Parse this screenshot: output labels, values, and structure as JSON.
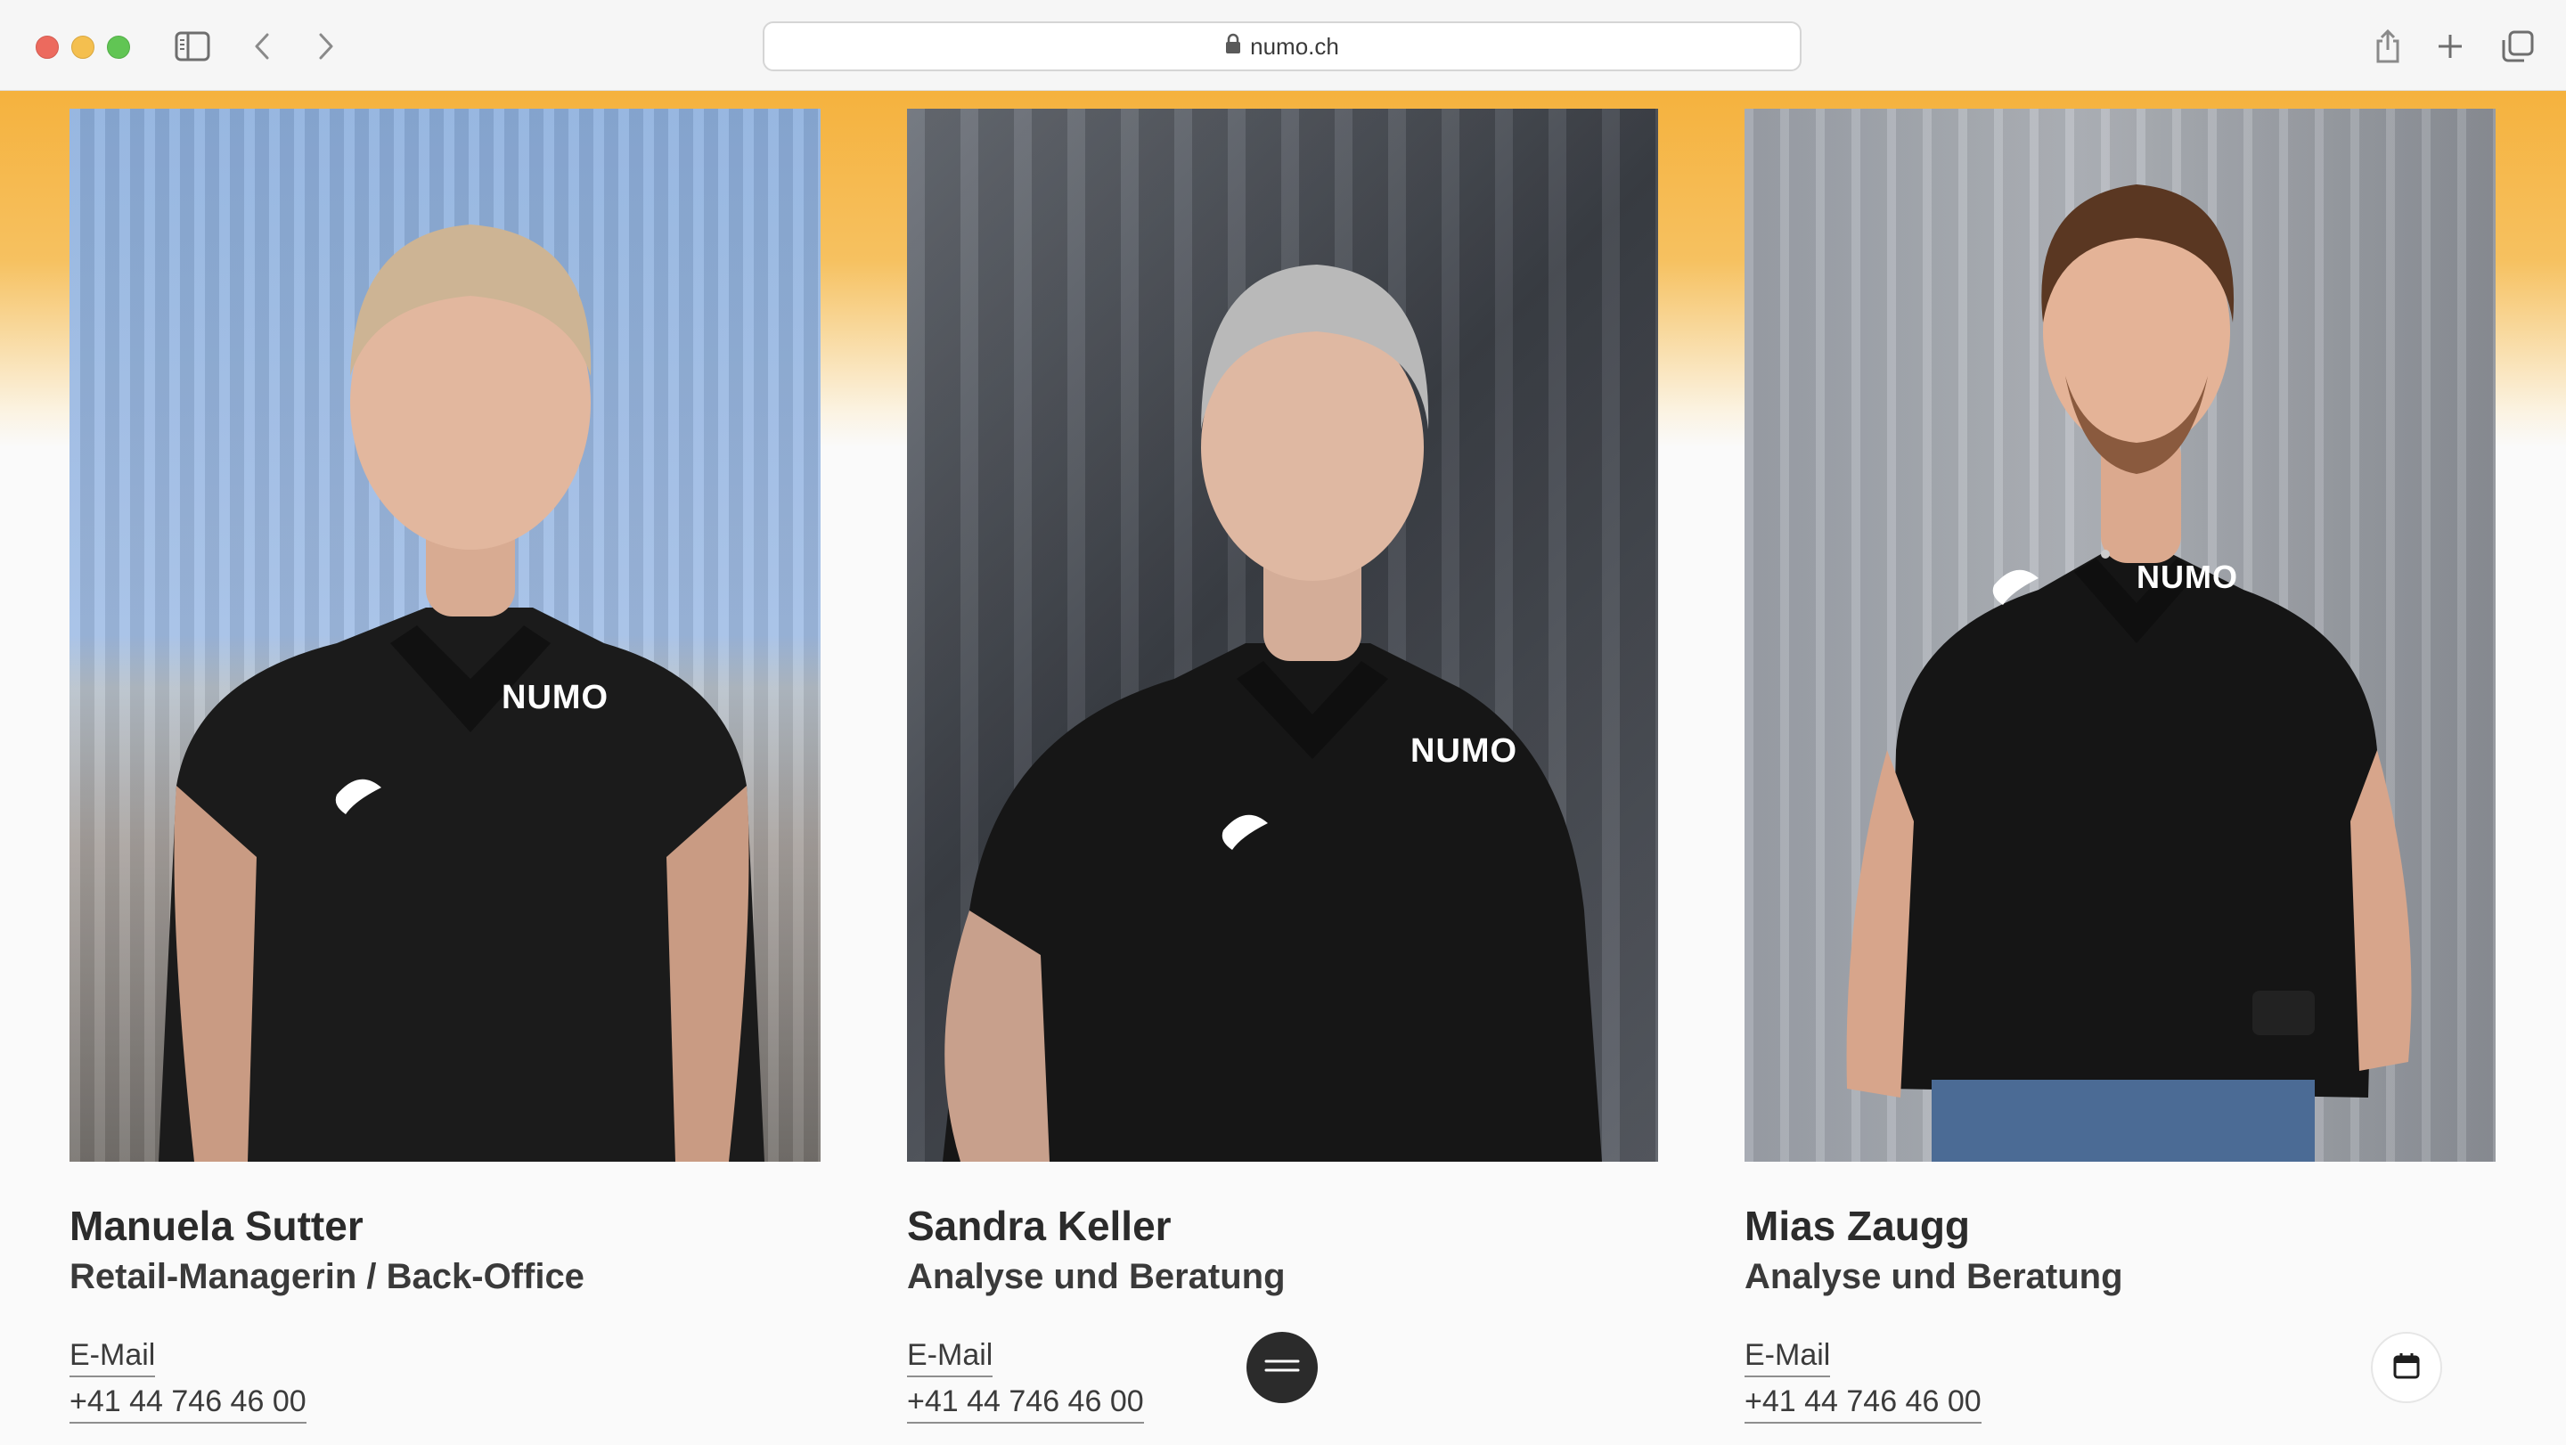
{
  "browser": {
    "url": "numo.ch",
    "icons": [
      "sidebar-toggle-icon",
      "back-chevron-icon",
      "forward-chevron-icon",
      "lock-icon",
      "share-icon",
      "plus-icon",
      "tabs-overview-icon"
    ]
  },
  "team": [
    {
      "name": "Manuela Sutter",
      "role": "Retail-Managerin / Back-Office",
      "email_label": "E-Mail",
      "phone": "+41 44 746 46 00",
      "shirt_brand": "NUMO"
    },
    {
      "name": "Sandra Keller",
      "role": "Analyse und Beratung",
      "email_label": "E-Mail",
      "phone": "+41 44 746 46 00",
      "shirt_brand": "NUMO"
    },
    {
      "name": "Mias Zaugg",
      "role": "Analyse und Beratung",
      "email_label": "E-Mail",
      "phone": "+41 44 746 46 00",
      "shirt_brand": "NUMO"
    }
  ],
  "floating": {
    "menu_icon": "menu-icon",
    "calendar_icon": "calendar-icon"
  },
  "colors": {
    "accent": "#f5b23e",
    "text": "#2b2b2b",
    "button_dark": "#2b2b2b"
  }
}
